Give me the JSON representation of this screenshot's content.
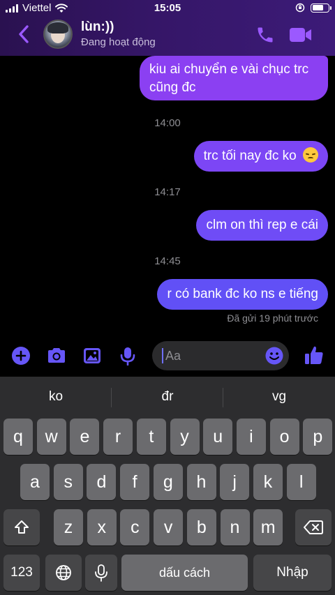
{
  "status": {
    "carrier": "Viettel",
    "time": "15:05",
    "battery_level": 0.7
  },
  "header": {
    "name": "lùn:))",
    "status": "Đang hoạt động",
    "accent": "#9b59ff"
  },
  "messages": [
    {
      "text_line1": "kiu ai chuyển e vài chục trc",
      "text_line2": "cũng đc"
    },
    {
      "time": "14:00"
    },
    {
      "text": "trc tối nay đc ko",
      "emoji": "disappointed-face"
    },
    {
      "time": "14:17"
    },
    {
      "text": "clm on thì rep e cái"
    },
    {
      "time": "14:45"
    },
    {
      "text": "r có bank đc ko ns e tiếng"
    }
  ],
  "sent_receipt": "Đã gửi 19 phút trước",
  "composer": {
    "placeholder": "Aa"
  },
  "keyboard": {
    "suggestions": [
      "ko",
      "đr",
      "vg"
    ],
    "row1": [
      "q",
      "w",
      "e",
      "r",
      "t",
      "y",
      "u",
      "i",
      "o",
      "p"
    ],
    "row2": [
      "a",
      "s",
      "d",
      "f",
      "g",
      "h",
      "j",
      "k",
      "l"
    ],
    "row3": [
      "z",
      "x",
      "c",
      "v",
      "b",
      "n",
      "m"
    ],
    "numbers_label": "123",
    "space_label": "dấu cách",
    "return_label": "Nhập"
  }
}
